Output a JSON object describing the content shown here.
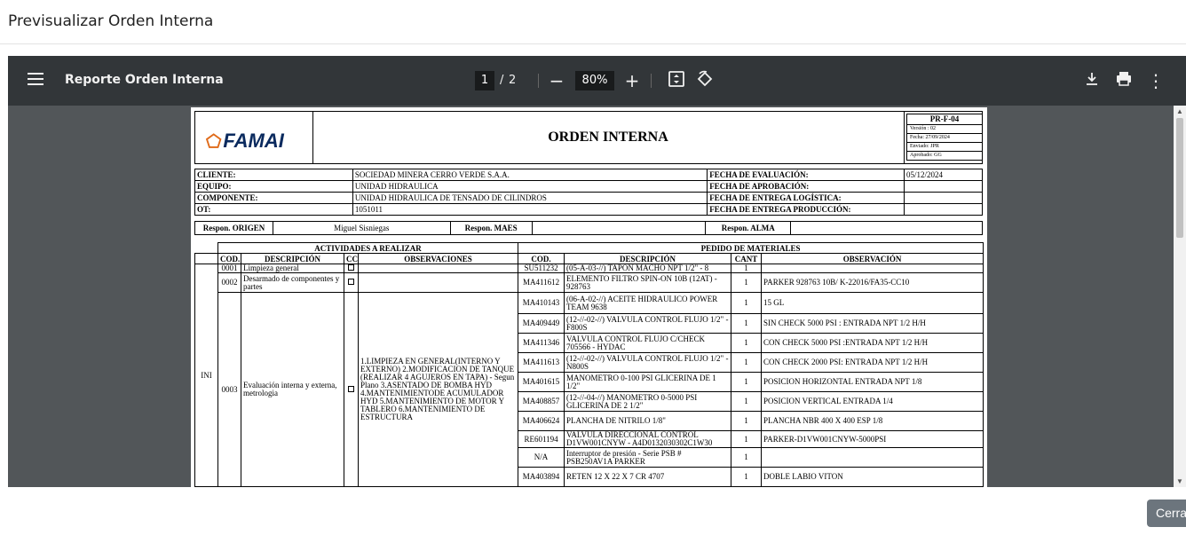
{
  "modal": {
    "title": "Previsualizar Orden Interna",
    "close_label": "Cerrar"
  },
  "viewer": {
    "document_title": "Reporte Orden Interna",
    "current_page": "1",
    "page_separator": "/",
    "total_pages": "2",
    "zoom": "80%",
    "icons": [
      "menu-icon",
      "zoom-out-icon",
      "zoom-in-icon",
      "fit-page-icon",
      "rotate-icon",
      "download-icon",
      "print-icon",
      "more-options-icon"
    ]
  },
  "doc": {
    "logo_text": "FAMAI",
    "title": "ORDEN INTERNA",
    "code": "PR-F-04",
    "version": "Versión : 02",
    "fecha": "Fecha: 27/09/2024",
    "enviado": "Enviado: JPR",
    "aprobado": "Aprobado: GG",
    "info": [
      {
        "label": "CLIENTE:",
        "value": "SOCIEDAD MINERA CERRO VERDE S.A.A.",
        "label2": "FECHA DE EVALUACIÓN:",
        "value2": "05/12/2024"
      },
      {
        "label": "EQUIPO:",
        "value": "UNIDAD HIDRAULICA",
        "label2": "FECHA DE APROBACIÓN:",
        "value2": ""
      },
      {
        "label": "COMPONENTE:",
        "value": "UNIDAD HIDRAULICA DE TENSADO DE CILINDROS",
        "label2": "FECHA DE ENTREGA LOGÍSTICA:",
        "value2": ""
      },
      {
        "label": "OT:",
        "value": "1051011",
        "label2": "FECHA DE ENTREGA PRODUCCIÓN:",
        "value2": ""
      }
    ],
    "resp": {
      "origen_label": "Respon. ORIGEN",
      "origen_value": "Miguel Sisniegas",
      "maes_label": "Respon. MAES",
      "maes_value": "",
      "alma_label": "Respon. ALMA",
      "alma_value": ""
    },
    "headers": {
      "actividades": "ACTIVIDADES A REALIZAR",
      "pedido": "PEDIDO DE MATERIALES",
      "cod": "COD.",
      "descripcion": "DESCRIPCIÓN",
      "cc": "CC",
      "observaciones": "OBSERVACIONES",
      "mcod": "COD.",
      "mdesc": "DESCRIPCIÓN",
      "cant": "CANT",
      "obs": "OBSERVACIÓN"
    },
    "stage": "INI",
    "activities": [
      {
        "cod": "0001",
        "desc": "Limpieza general",
        "obs": ""
      },
      {
        "cod": "0002",
        "desc": "Desarmado de componentes y partes",
        "obs": ""
      },
      {
        "cod": "0003",
        "desc": "Evaluación interna y externa, metrologia",
        "obs": "1.LIMPIEZA EN GENERAL(INTERNO Y EXTERNO) 2.MODIFICACION DE TANQUE (REALIZAR 4 AGUJEROS EN TAPA) - Segun Plano 3.ASENTADO DE BOMBA HYD 4.MANTENIMIENTODE ACUMULADOR HYD 5.MANTENIMIENTO DE MOTOR Y TABLERO 6.MANTENIMIENTO DE ESTRUCTURA"
      }
    ],
    "materials": [
      {
        "cod": "SU511232",
        "desc": "(05-A-03-//) TAPON MACHO NPT 1/2\" - 8",
        "cant": "1",
        "obs": ""
      },
      {
        "cod": "MA411612",
        "desc": "ELEMENTO FILTRO SPIN-ON 10B (12AT) - 928763",
        "cant": "1",
        "obs": "PARKER 928763 10B/ K-22016/FA35-CC10"
      },
      {
        "cod": "MA410143",
        "desc": "(06-A-02-//) ACEITE HIDRAULICO POWER TEAM 9638",
        "cant": "1",
        "obs": "15 GL"
      },
      {
        "cod": "MA409449",
        "desc": "(12-//-02-//) VALVULA CONTROL FLUJO 1/2\" - F800S",
        "cant": "1",
        "obs": "SIN CHECK 5000 PSI : ENTRADA NPT 1/2 H/H"
      },
      {
        "cod": "MA411346",
        "desc": "VALVULA CONTROL FLUJO C/CHECK 705566 - HYDAC",
        "cant": "1",
        "obs": "CON CHECK 5000 PSI :ENTRADA NPT 1/2 H/H"
      },
      {
        "cod": "MA411613",
        "desc": "(12-//-02-//) VALVULA CONTROL FLUJO 1/2\" - N800S",
        "cant": "1",
        "obs": "CON CHECK 2000 PSI: ENTRADA NPT 1/2 H/H"
      },
      {
        "cod": "MA401615",
        "desc": "MANOMETRO 0-100 PSI GLICERINA DE 1 1/2\"",
        "cant": "1",
        "obs": "POSICION HORIZONTAL ENTRADA NPT 1/8"
      },
      {
        "cod": "MA408857",
        "desc": "(12-//-04-//) MANOMETRO 0-5000 PSI GLICERINA DE 2 1/2\"",
        "cant": "1",
        "obs": "POSICION VERTICAL ENTRADA 1/4"
      },
      {
        "cod": "MA406624",
        "desc": "PLANCHA DE NITRILO 1/8\"",
        "cant": "1",
        "obs": "PLANCHA NBR 400 X 400 ESP 1/8"
      },
      {
        "cod": "RE601194",
        "desc": "VALVULA DIRECCIONAL CONTROL D1VW001CNYW - A4D0132030302C1W30",
        "cant": "1",
        "obs": "PARKER-D1VW001CNYW-5000PSI"
      },
      {
        "cod": "N/A",
        "desc": "Interruptor de presión - Serie PSB # PSB250AV1A PARKER",
        "cant": "1",
        "obs": ""
      },
      {
        "cod": "MA403894",
        "desc": "RETEN 12 X 22 X 7 CR 4707",
        "cant": "1",
        "obs": "DOBLE LABIO VITON"
      }
    ]
  }
}
